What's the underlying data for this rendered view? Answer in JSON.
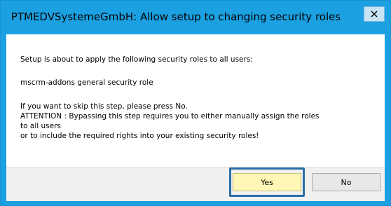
{
  "dialog": {
    "title": "PTMEDVSystemeGmbH: Allow setup to changing security roles",
    "close_icon": "close-icon",
    "lines": [
      "Setup is about to apply the following security roles to all users:",
      "mscrm-addons general security role",
      "If you want to skip this step, please press No.",
      "ATTENTION : Bypassing this step requires you to either manually assign the roles",
      "to all users",
      "or to include the required rights into your existing security roles!"
    ],
    "buttons": {
      "yes": "Yes",
      "no": "No"
    }
  },
  "colors": {
    "titlebar": "#1ba1e2",
    "yes_highlight": "#fff7b5",
    "focus_frame": "#2b6ea7"
  }
}
